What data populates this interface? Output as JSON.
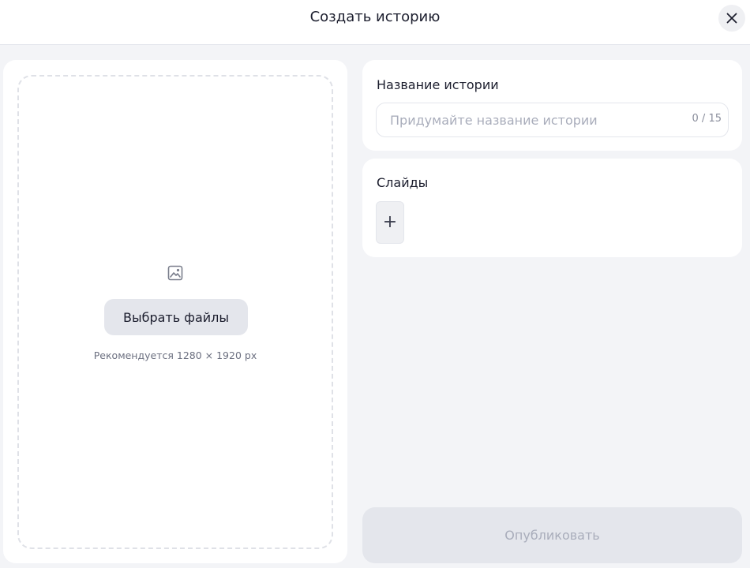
{
  "header": {
    "title": "Создать историю",
    "close_icon": "close-icon"
  },
  "upload": {
    "icon": "image-icon",
    "choose_label": "Выбрать файлы",
    "recommendation": "Рекомендуется 1280 × 1920 px"
  },
  "story_name": {
    "label": "Название истории",
    "value": "",
    "placeholder": "Придумайте название истории",
    "counter": "0 / 15"
  },
  "slides": {
    "label": "Слайды",
    "add_symbol": "+"
  },
  "publish": {
    "label": "Опубликовать",
    "disabled": true
  },
  "colors": {
    "background": "#f3f4f7",
    "panel": "#ffffff",
    "button_bg": "#e4e6ec",
    "text": "#1c1e2e",
    "muted_text": "#a9adbb"
  }
}
